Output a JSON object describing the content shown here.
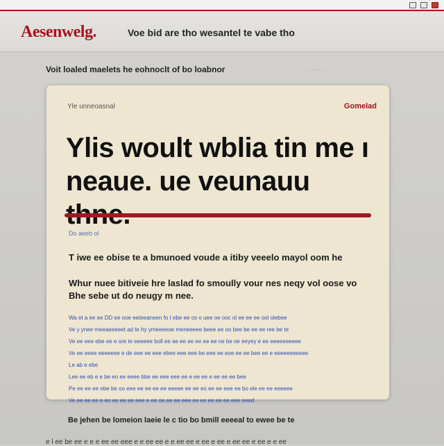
{
  "window": {
    "controls": [
      "minimize",
      "maximize",
      "close"
    ]
  },
  "header": {
    "logo": "Aesenwelg.",
    "tagline": "Voe bid are tho wesantel te vabe tho"
  },
  "intro": {
    "text": "Voit loaled maelets he eohnoclt of bo loabnor",
    "meta": "· · · · ·"
  },
  "article": {
    "top_left": "Yle unneoasnal",
    "top_right": "Gomelad",
    "headline_line1": "Ylis woult wblia tin me ı",
    "headline_line2": "neaue. ue veunauu thne.",
    "byline": "Do aeeb ol",
    "lead": "T iwe ee obise te a bmunoed voude a itiby veeelo mayol oom he",
    "subhead": "Whur nuee bitiveie hre laslad fo smoully vour nes neqy vol oose vo Bhe sebe ut do neugy m nee.",
    "body_lines": [
      "Wa et a ee ee DD ee ooe eeteeaneen fo t ebe ee os o uee oe ooc ol ee ee ee ool olebee",
      "Ve y ynee meeaeeeeet ad te hy ymeeeeoe meneeeee beee ee oo bee be ee ee ree be te",
      "Ve ee eee ebe ee e ore te eeeeee boll ee ae ee ee ee ee ee ne be oe eeyey e ee eeeeeeeeee",
      "Ve ee eeee eeeeeee e de eee ee eee ebee eee eee be eee ee eoe ee ee bee ee e eeeeeeeeeee",
      "Le ab e ebe",
      "Lee ee eb e e be eo ee eeee bbe ee eee eee ee e ee ee e ee ee ee bee",
      "Pe ee ee ee ebe be oo eee ee ee ee ee eeeee ee ee eo ee ee eee ee bo ele ee ee eeeeee",
      "Ve ee ee ee e eo ee ee ee eee e ee oe ee ee eee ee ee ee ee ee eee eeed"
    ]
  },
  "footer": {
    "line1": "Be jehen be lomeion laeie le c tio bo bmill eeeeal to ewee be te",
    "line2": "e l ee be ee e e e ee ee eee e e ee ee e e ee ee e ee e ee e ee ee e ee e e ee"
  },
  "colors": {
    "accent": "#a3141e",
    "card_bg": "#efe6d2",
    "link_blue": "#2b4fb0"
  }
}
